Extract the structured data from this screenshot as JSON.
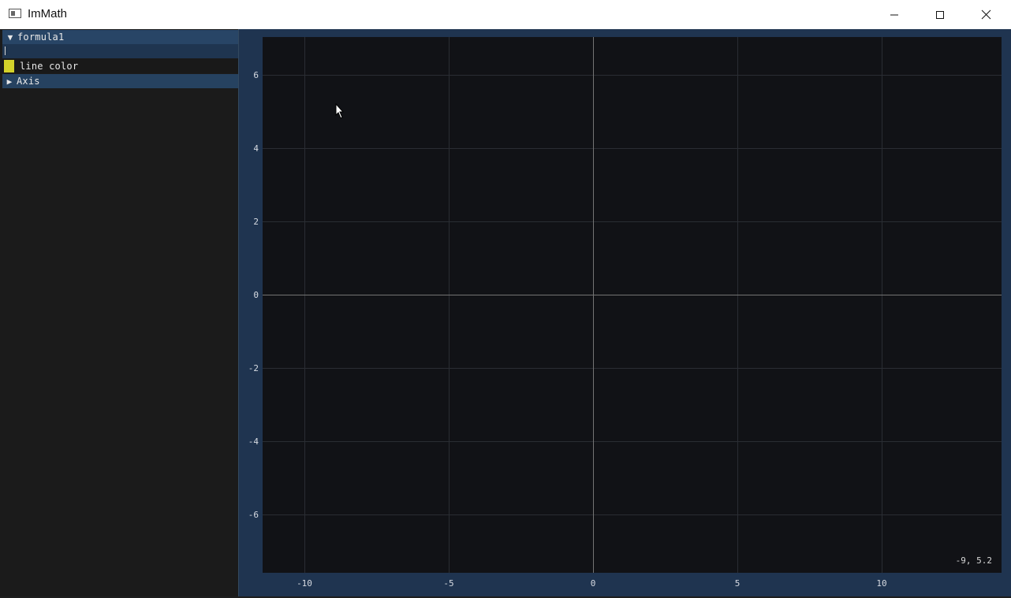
{
  "window": {
    "title": "ImMath",
    "icon": "app-window-icon",
    "controls": [
      "minimize-icon",
      "maximize-icon",
      "close-icon"
    ]
  },
  "sidebar": {
    "formula_header": {
      "arrow": "▼",
      "label": "formula1"
    },
    "formula_input": {
      "value": ""
    },
    "line_color": {
      "label": "line color",
      "color": "#d3d22a"
    },
    "axis_header": {
      "arrow": "▶",
      "label": "Axis"
    }
  },
  "plot": {
    "x_ticks": [
      "-10",
      "-5",
      "0",
      "5",
      "10"
    ],
    "y_ticks": [
      "6",
      "4",
      "2",
      "0",
      "-2",
      "-4",
      "-6"
    ],
    "coordinate_readout": "-9, 5.2",
    "colors": {
      "background": "#111216",
      "frame": "#1f3450",
      "grid": "#2a2d33",
      "axis": "#747474"
    }
  }
}
